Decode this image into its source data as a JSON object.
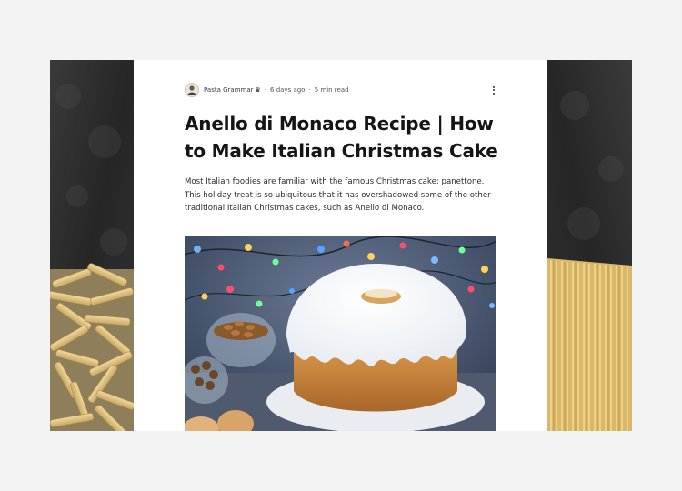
{
  "post": {
    "author": "Pasta Grammar",
    "crown_icon": "crown-icon",
    "separator": "·",
    "posted": "6 days ago",
    "read_time": "5 min read",
    "more_icon": "more-vertical-icon",
    "title": "Anello di Monaco Recipe | How to Make Italian Christmas Cake",
    "intro": "Most Italian foodies are familiar with the famous Christmas cake: panettone. This holiday treat is so ubiquitous that it has overshadowed some of the other traditional Italian Christmas cakes, such as Anello di Monaco.",
    "hero_image": "cake-with-white-icing-and-christmas-lights"
  },
  "decor": {
    "left_panel": "penne-pasta-on-dark-slate",
    "right_panel": "spaghetti-on-dark-slate"
  },
  "colors": {
    "page_background": "#f3f3f3",
    "card_background": "#ffffff",
    "title_text": "#151515",
    "body_text": "#2a2a2a"
  }
}
